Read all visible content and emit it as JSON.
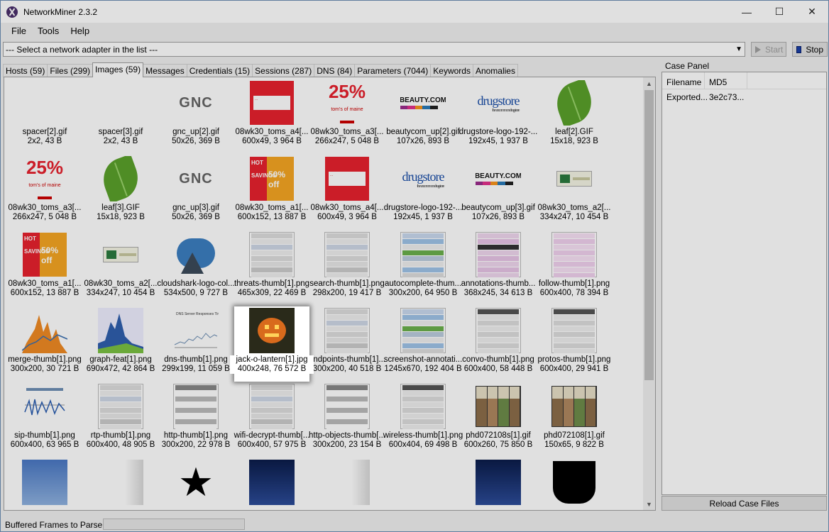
{
  "window": {
    "title": "NetworkMiner 2.3.2",
    "minimize": "—",
    "maximize": "☐",
    "close": "✕"
  },
  "menu": [
    "File",
    "Tools",
    "Help"
  ],
  "toolbar": {
    "adapter_placeholder": "--- Select a network adapter in the list ---",
    "start_label": "Start",
    "stop_label": "Stop"
  },
  "tabs": [
    {
      "label": "Hosts (59)",
      "active": false
    },
    {
      "label": "Files (299)",
      "active": false
    },
    {
      "label": "Images (59)",
      "active": true
    },
    {
      "label": "Messages",
      "active": false
    },
    {
      "label": "Credentials (15)",
      "active": false
    },
    {
      "label": "Sessions (287)",
      "active": false
    },
    {
      "label": "DNS (84)",
      "active": false
    },
    {
      "label": "Parameters (7044)",
      "active": false
    },
    {
      "label": "Keywords",
      "active": false
    },
    {
      "label": "Anomalies",
      "active": false
    }
  ],
  "images": [
    {
      "name": "spacer[2].gif",
      "info": "2x2, 43 B",
      "icon": "blank-thumb"
    },
    {
      "name": "spacer[3].gif",
      "info": "2x2, 43 B",
      "icon": "blank-thumb"
    },
    {
      "name": "gnc_up[2].gif",
      "info": "50x26, 369 B",
      "icon": "gnc-logo-thumb",
      "text": "GNC"
    },
    {
      "name": "08wk30_toms_a4[...",
      "info": "600x49, 3 964 B",
      "icon": "red-banner-thumb"
    },
    {
      "name": "08wk30_toms_a3[...",
      "info": "266x247, 5 048 B",
      "icon": "toms-25-off-thumb",
      "text": "25%"
    },
    {
      "name": "beautycom_up[2].gif",
      "info": "107x26, 893 B",
      "icon": "beauty-logo-thumb",
      "text": "BEAUTY.COM"
    },
    {
      "name": "drugstore-logo-192-...",
      "info": "192x45, 1 937 B",
      "icon": "drugstore-logo-thumb",
      "text": "drugstore"
    },
    {
      "name": "leaf[2].GIF",
      "info": "15x18, 923 B",
      "icon": "leaf-thumb"
    },
    {
      "name": "08wk30_toms_a3[...",
      "info": "266x247, 5 048 B",
      "icon": "toms-25-off-thumb",
      "text": "25%"
    },
    {
      "name": "leaf[3].GIF",
      "info": "15x18, 923 B",
      "icon": "leaf-thumb"
    },
    {
      "name": "gnc_up[3].gif",
      "info": "50x26, 369 B",
      "icon": "gnc-logo-thumb",
      "text": "GNC"
    },
    {
      "name": "08wk30_toms_a1[...",
      "info": "600x152, 13 887 B",
      "icon": "hot-savings-thumb",
      "text": "50% off"
    },
    {
      "name": "08wk30_toms_a4[...",
      "info": "600x49, 3 964 B",
      "icon": "red-banner-thumb"
    },
    {
      "name": "drugstore-logo-192-...",
      "info": "192x45, 1 937 B",
      "icon": "drugstore-logo-thumb",
      "text": "drugstore"
    },
    {
      "name": "beautycom_up[3].gif",
      "info": "107x26, 893 B",
      "icon": "beauty-logo-thumb",
      "text": "BEAUTY.COM"
    },
    {
      "name": "08wk30_toms_a2[...",
      "info": "334x247, 10 454 B",
      "icon": "gum-pack-thumb"
    },
    {
      "name": "08wk30_toms_a1[...",
      "info": "600x152, 13 887 B",
      "icon": "hot-savings-thumb",
      "text": "50% off"
    },
    {
      "name": "08wk30_toms_a2[...",
      "info": "334x247, 10 454 B",
      "icon": "gum-pack-thumb"
    },
    {
      "name": "cloudshark-logo-col...",
      "info": "534x500, 9 727 B",
      "icon": "cloudshark-logo-thumb"
    },
    {
      "name": "threats-thumb[1].png",
      "info": "465x309, 22 469 B",
      "icon": "screenshot-thumb"
    },
    {
      "name": "search-thumb[1].png",
      "info": "298x200, 19 417 B",
      "icon": "screenshot-thumb"
    },
    {
      "name": "autocomplete-thum...",
      "info": "300x200, 64 950 B",
      "icon": "screenshot-blue-thumb"
    },
    {
      "name": "annotations-thumb...",
      "info": "368x245, 34 613 B",
      "icon": "screenshot-pink-thumb"
    },
    {
      "name": "follow-thumb[1].png",
      "info": "600x400, 78 394 B",
      "icon": "text-pink-thumb"
    },
    {
      "name": "merge-thumb[1].png",
      "info": "300x200, 30 721 B",
      "icon": "orange-chart-thumb"
    },
    {
      "name": "graph-feat[1].png",
      "info": "690x472, 42 864 B",
      "icon": "blue-area-chart-thumb"
    },
    {
      "name": "dns-thumb[1].png",
      "info": "299x199, 11 059 B",
      "icon": "line-chart-thumb"
    },
    {
      "name": "jack-o-lantern[1].jpg",
      "info": "400x248, 76 572 B",
      "icon": "pumpkin-thumb"
    },
    {
      "name": "endpoints-thumb[1]...",
      "info": "300x200, 40 518 B",
      "icon": "screenshot-thumb"
    },
    {
      "name": "screenshot-annotati...",
      "info": "1245x670, 192 404 B",
      "icon": "screenshot-blue-thumb"
    },
    {
      "name": "convo-thumb[1].png",
      "info": "600x400, 58 448 B",
      "icon": "table-thumb"
    },
    {
      "name": "protos-thumb[1].png",
      "info": "600x400, 29 941 B",
      "icon": "table-thumb"
    },
    {
      "name": "sip-thumb[1].png",
      "info": "600x400, 63 965 B",
      "icon": "sip-flow-thumb"
    },
    {
      "name": "rtp-thumb[1].png",
      "info": "600x400, 48 905 B",
      "icon": "screenshot-thumb"
    },
    {
      "name": "http-thumb[1].png",
      "info": "300x200, 22 978 B",
      "icon": "text-list-thumb"
    },
    {
      "name": "wifi-decrypt-thumb[...",
      "info": "600x400, 57 975 B",
      "icon": "screenshot-thumb"
    },
    {
      "name": "http-objects-thumb[...",
      "info": "300x200, 23 154 B",
      "icon": "text-list-thumb"
    },
    {
      "name": "wireless-thumb[1].png",
      "info": "600x404, 69 498 B",
      "icon": "table-thumb"
    },
    {
      "name": "phd072108s[1].gif",
      "info": "600x260, 75 850 B",
      "icon": "comic-thumb"
    },
    {
      "name": "phd072108[1].gif",
      "info": "150x65, 9 822 B",
      "icon": "comic-thumb"
    },
    {
      "name": "",
      "info": "",
      "icon": "blue-gradient-thumb"
    },
    {
      "name": "",
      "info": "",
      "icon": "white-fade-thumb"
    },
    {
      "name": "",
      "info": "",
      "icon": "star-thumb"
    },
    {
      "name": "",
      "info": "",
      "icon": "dark-blue-gradient-thumb"
    },
    {
      "name": "",
      "info": "",
      "icon": "white-fade-thumb"
    },
    {
      "name": "",
      "info": "",
      "icon": "blank-thumb"
    },
    {
      "name": "",
      "info": "",
      "icon": "dark-blue-gradient-thumb"
    },
    {
      "name": "",
      "info": "",
      "icon": "black-shape-thumb"
    }
  ],
  "selected_index": 27,
  "case_panel": {
    "title": "Case Panel",
    "columns": [
      "Filename",
      "MD5"
    ],
    "rows": [
      [
        "Exported...",
        "3e2c73..."
      ]
    ],
    "reload_label": "Reload Case Files"
  },
  "status": {
    "label": "Buffered Frames to Parse:"
  },
  "colors": {
    "window_bg": "#f0f0f0",
    "stop_blue": "#1a3fa8",
    "toms_red": "#e8222e",
    "leaf_green": "#5aa12b"
  }
}
